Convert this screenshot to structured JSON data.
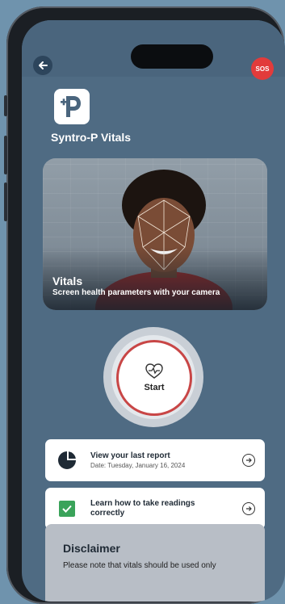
{
  "header": {
    "back_icon": "arrow-left-icon",
    "sos_label": "SOS"
  },
  "app": {
    "logo_icon": "syntro-p-plus-logo",
    "title": "Syntro-P Vitals"
  },
  "hero": {
    "title": "Vitals",
    "subtitle": "Screen health parameters with your camera"
  },
  "start": {
    "icon": "heart-pulse-icon",
    "label": "Start"
  },
  "cards": [
    {
      "icon": "pie-chart-icon",
      "title": "View your last report",
      "subtitle": "Date: Tuesday, January 16, 2024",
      "arrow_icon": "arrow-right-circle-icon"
    },
    {
      "icon": "checkbox-icon",
      "title": "Learn how to take readings correctly",
      "arrow_icon": "arrow-right-circle-icon"
    }
  ],
  "disclaimer": {
    "title": "Disclaimer",
    "text": "Please note that vitals should be used only"
  },
  "colors": {
    "background": "#6f93ad",
    "screen": "#4f6b83",
    "sos": "#e23b3b",
    "start_ring": "#c84646",
    "check_green": "#3aa35a"
  }
}
